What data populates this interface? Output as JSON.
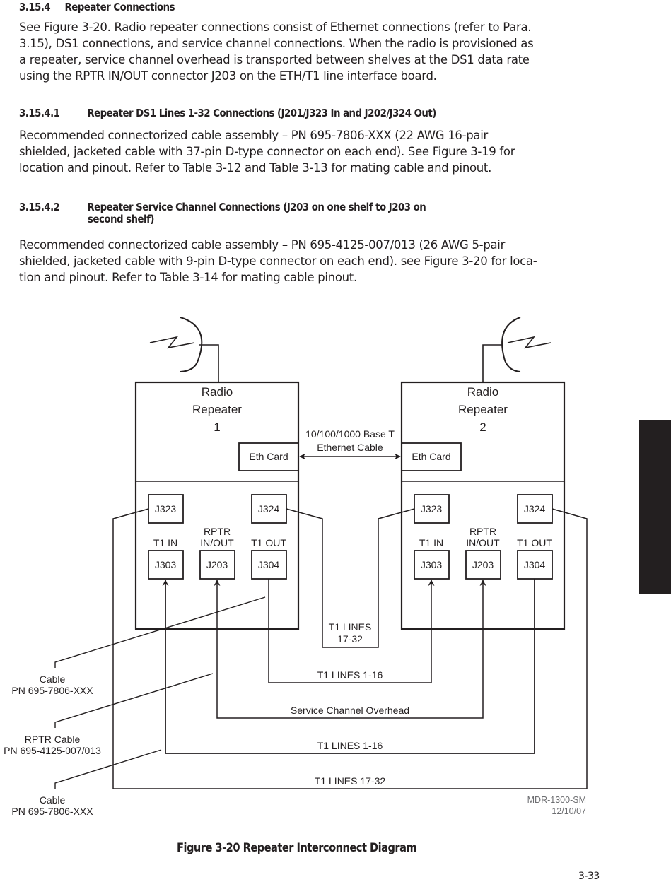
{
  "sections": [
    {
      "number": "3.15.4",
      "title": "Repeater Connections",
      "body": [
        "See Figure 3-20. Radio repeater connections consist of Ethernet connections (refer to Para.",
        "3.15), DS1 connections, and service channel connections. When the radio is provisioned as",
        "a repeater, service channel overhead is transported between shelves at the DS1 data rate",
        "using the RPTR IN/OUT connector J203 on the ETH/T1 line interface board."
      ]
    },
    {
      "number": "3.15.4.1",
      "title": "Repeater DS1 Lines 1-32 Connections (J201/J323 In and J202/J324 Out)",
      "body": [
        "Recommended connectorized cable assembly – PN 695-7806-XXX (22 AWG 16-pair",
        "shielded, jacketed cable with 37-pin D-type connector on each end). See Figure 3-19 for",
        "location and pinout. Refer to Table 3-12 and Table 3-13 for mating cable and pinout."
      ]
    },
    {
      "number": "3.15.4.2",
      "title": "Repeater Service Channel Connections (J203 on one shelf to J203 on",
      "title_cont": "second shelf)",
      "body": [
        "Recommended connectorized cable assembly – PN 695-4125-007/013 (26 AWG 5-pair",
        "shielded, jacketed cable with 9-pin D-type connector on each end). see Figure 3-20 for loca-",
        "tion and pinout. Refer to Table 3-14 for mating cable pinout."
      ]
    }
  ],
  "diagram": {
    "repeaters": [
      {
        "title_lines": [
          "Radio",
          "Repeater",
          "1"
        ],
        "eth_card": "Eth Card",
        "connectors": {
          "j323": "J323",
          "j324": "J324",
          "j303": "J303",
          "j203": "J203",
          "j304": "J304"
        },
        "labels": {
          "t1_in": "T1 IN",
          "rptr_1": "RPTR",
          "rptr_2": "IN/OUT",
          "t1_out": "T1 OUT"
        }
      },
      {
        "title_lines": [
          "Radio",
          "Repeater",
          "2"
        ],
        "eth_card": "Eth Card",
        "connectors": {
          "j323": "J323",
          "j324": "J324",
          "j303": "J303",
          "j203": "J203",
          "j304": "J304"
        },
        "labels": {
          "t1_in": "T1 IN",
          "rptr_1": "RPTR",
          "rptr_2": "IN/OUT",
          "t1_out": "T1 OUT"
        }
      }
    ],
    "ethernet_cable": [
      "10/100/1000 Base T",
      "Ethernet Cable"
    ],
    "wire_labels": {
      "t1_lines_17_32_mid": [
        "T1 LINES",
        "17-32"
      ],
      "t1_lines_1_16_a": "T1 LINES 1-16",
      "service_channel": "Service Channel Overhead",
      "t1_lines_1_16_b": "T1 LINES 1-16",
      "t1_lines_17_32_outer": "T1 LINES 17-32"
    },
    "callouts": [
      {
        "line1": "Cable",
        "line2": "PN 695-7806-XXX"
      },
      {
        "line1": "RPTR Cable",
        "line2": "PN 695-4125-007/013"
      },
      {
        "line1": "Cable",
        "line2": "PN 695-7806-XXX"
      }
    ],
    "doc_id": [
      "MDR-1300-SM",
      "12/10/07"
    ]
  },
  "figure_caption": "Figure 3-20  Repeater Interconnect Diagram",
  "page_number": "3-33"
}
